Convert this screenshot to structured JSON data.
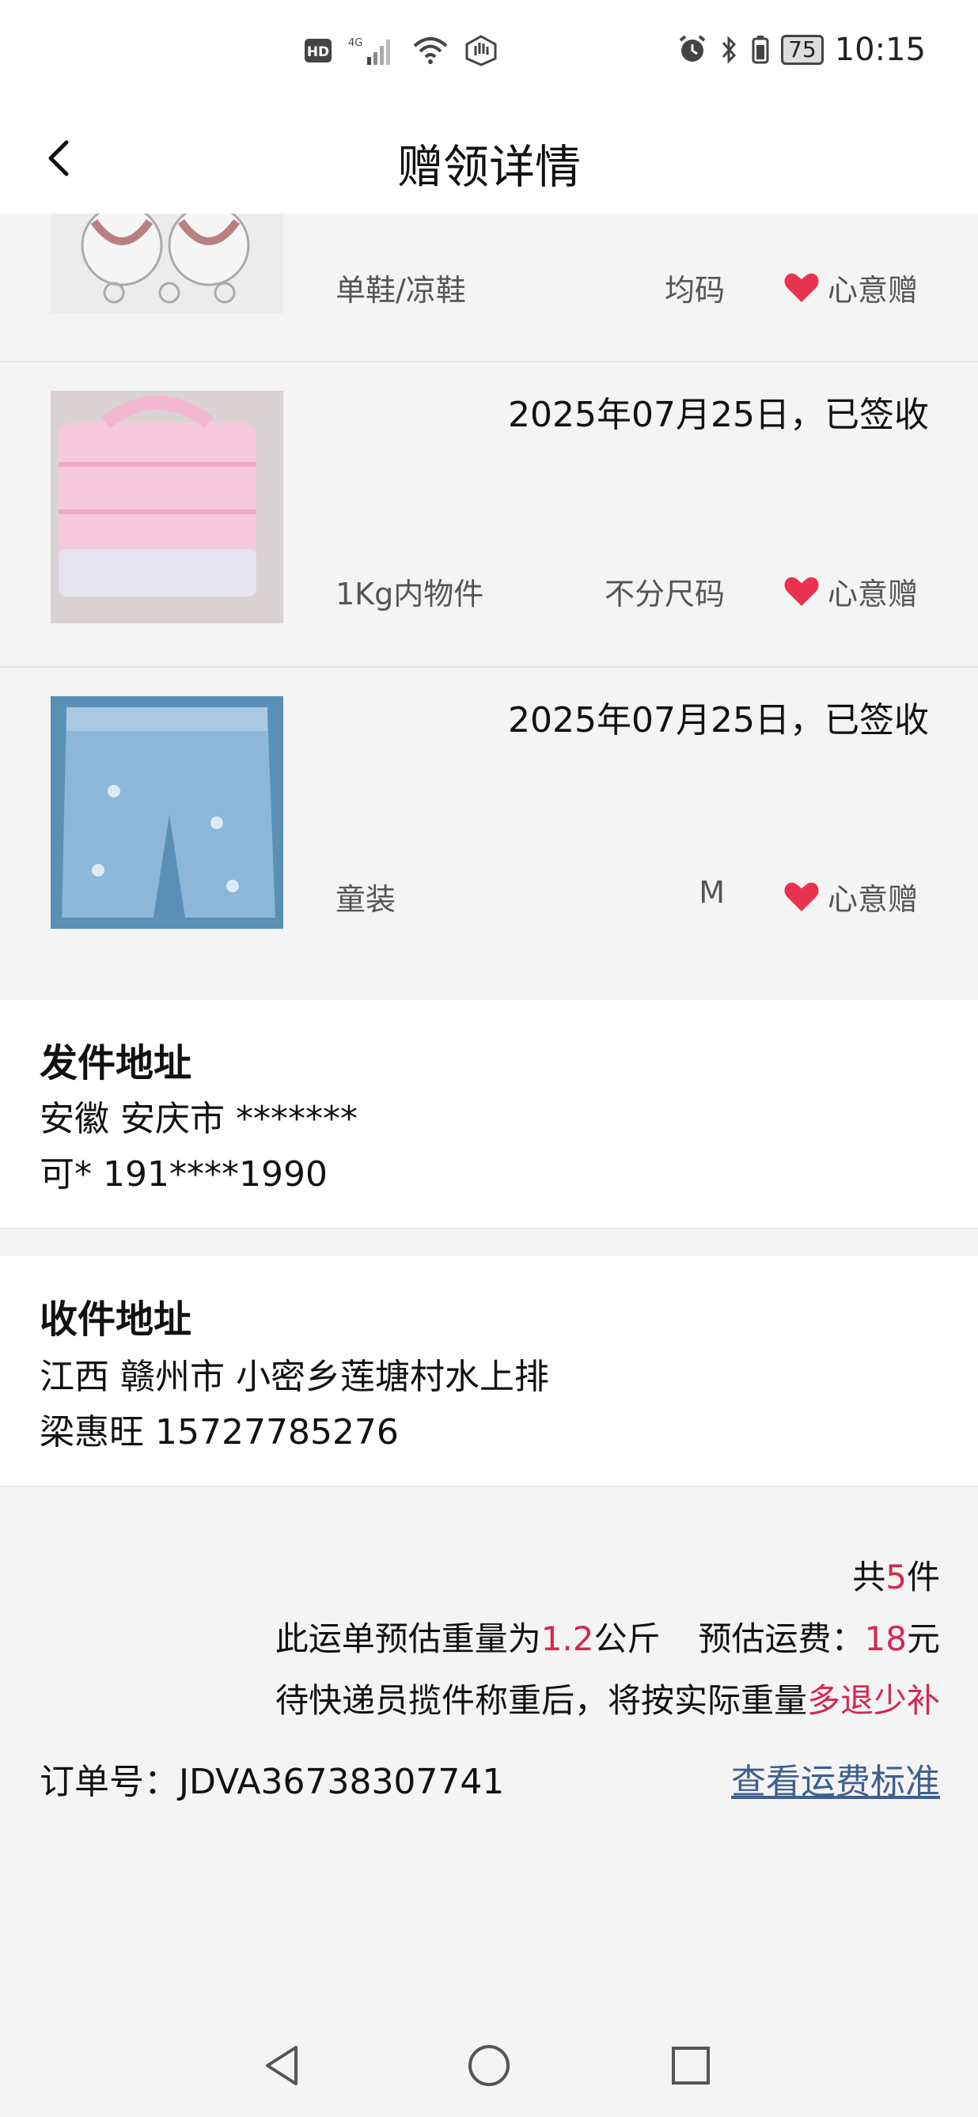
{
  "status_bar": {
    "time": "10:15",
    "battery": "75",
    "left_icons": [
      "hd-icon",
      "signal-4g-icon",
      "wifi-icon",
      "hand-icon"
    ],
    "right_icons": [
      "alarm-icon",
      "bluetooth-icon",
      "battery-icon"
    ]
  },
  "header": {
    "title": "赠领详情"
  },
  "items": [
    {
      "date": "",
      "category": "单鞋/凉鞋",
      "size": "均码",
      "tag": "心意赠"
    },
    {
      "date": "2025年07月25日，已签收",
      "category": "1Kg内物件",
      "size": "不分尺码",
      "tag": "心意赠"
    },
    {
      "date": "2025年07月25日，已签收",
      "category": "童装",
      "size": "M",
      "tag": "心意赠"
    }
  ],
  "sender": {
    "heading": "发件地址",
    "line1": "安徽 安庆市 *******",
    "line2": "可* 191****1990"
  },
  "receiver": {
    "heading": "收件地址",
    "line1": "江西 赣州市 小密乡莲塘村水上排",
    "line2": "梁惠旺 15727785276"
  },
  "summary": {
    "total_prefix": "共",
    "total_count": "5",
    "total_suffix": "件",
    "weight_prefix": "此运单预估重量为",
    "weight_value": "1.2",
    "weight_unit": "公斤",
    "fee_prefix": "预估运费：",
    "fee_value": "18",
    "fee_unit": "元",
    "note_prefix": "待快递员揽件称重后，将按实际重量",
    "note_highlight": "多退少补",
    "order_label": "订单号：JDVA36738307741",
    "rates_link": "查看运费标准"
  },
  "colors": {
    "accent": "#d5284f",
    "heart": "#e8334f",
    "link": "#3f5f8f"
  }
}
